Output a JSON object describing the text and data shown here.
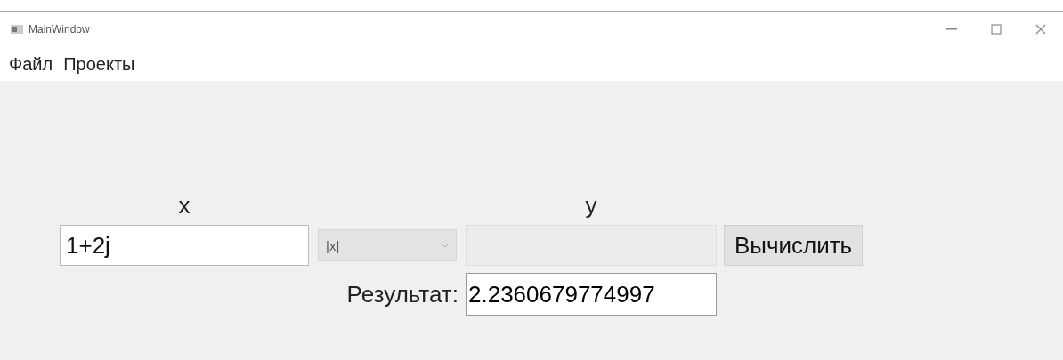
{
  "window": {
    "title": "MainWindow"
  },
  "menu": [
    "Файл",
    "Проекты"
  ],
  "form": {
    "x_label": "x",
    "y_label": "y",
    "x_field": {
      "value": "1+2j"
    },
    "operation": {
      "value": "|x|"
    },
    "y_field": {
      "disabled": true
    },
    "calculate_button": "Вычислить",
    "result_label": "Результат:",
    "result_field": {
      "value": "2.2360679774997"
    }
  }
}
